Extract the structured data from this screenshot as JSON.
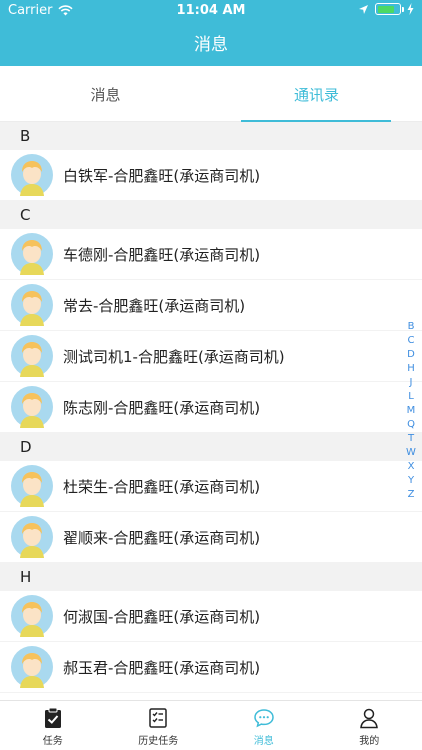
{
  "status_bar": {
    "carrier": "Carrier",
    "time": "11:04 AM",
    "battery_level": 0.8
  },
  "header": {
    "title": "消息"
  },
  "tabs": [
    {
      "label": "消息",
      "active": false
    },
    {
      "label": "通讯录",
      "active": true
    }
  ],
  "contacts": [
    {
      "letter": "B",
      "items": [
        "白铁军-合肥鑫旺(承运商司机)"
      ]
    },
    {
      "letter": "C",
      "items": [
        "车德刚-合肥鑫旺(承运商司机)",
        "常去-合肥鑫旺(承运商司机)",
        "测试司机1-合肥鑫旺(承运商司机)",
        "陈志刚-合肥鑫旺(承运商司机)"
      ]
    },
    {
      "letter": "D",
      "items": [
        "杜荣生-合肥鑫旺(承运商司机)",
        "翟顺来-合肥鑫旺(承运商司机)"
      ]
    },
    {
      "letter": "H",
      "items": [
        "何淑国-合肥鑫旺(承运商司机)",
        "郝玉君-合肥鑫旺(承运商司机)"
      ]
    }
  ],
  "index_letters": [
    "B",
    "C",
    "D",
    "H",
    "J",
    "L",
    "M",
    "Q",
    "T",
    "W",
    "X",
    "Y",
    "Z"
  ],
  "tabbar": [
    {
      "label": "任务",
      "icon": "clipboard-check-icon",
      "active": false
    },
    {
      "label": "历史任务",
      "icon": "checklist-icon",
      "active": false
    },
    {
      "label": "消息",
      "icon": "chat-bubble-icon",
      "active": true
    },
    {
      "label": "我的",
      "icon": "user-icon",
      "active": false
    }
  ],
  "colors": {
    "accent": "#3fbcd8",
    "index": "#3f8ee0",
    "section_bg": "#f2f2f2"
  }
}
